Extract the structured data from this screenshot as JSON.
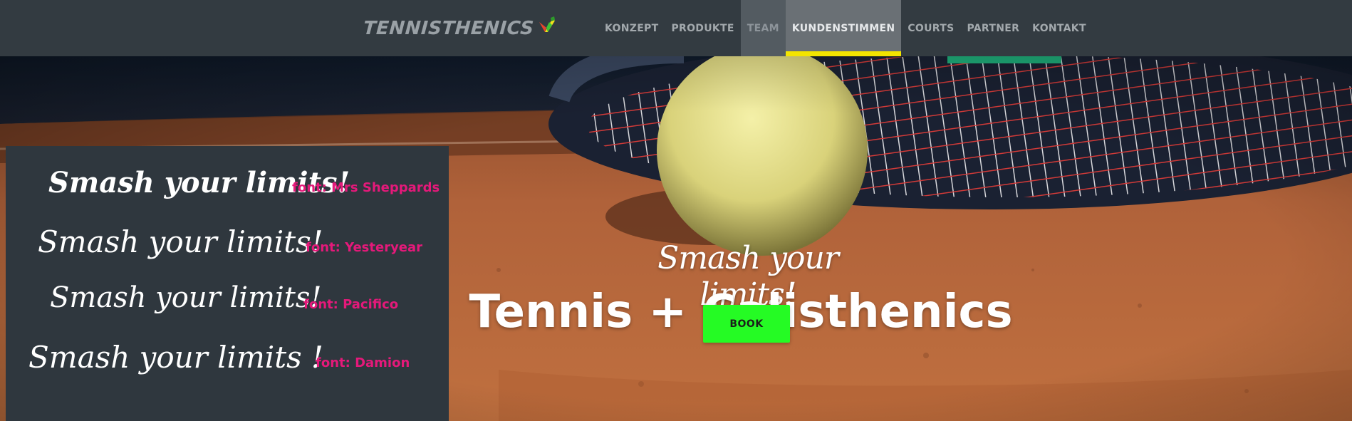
{
  "brand": {
    "name": "TENNISTHENICS",
    "logo_icon": "color-swoosh-icon"
  },
  "nav": {
    "items": [
      {
        "label": "KONZEPT"
      },
      {
        "label": "PRODUKTE"
      },
      {
        "label": "TEAM"
      },
      {
        "label": "KUNDENSTIMMEN"
      },
      {
        "label": "COURTS"
      },
      {
        "label": "PARTNER"
      },
      {
        "label": "KONTAKT"
      }
    ],
    "active_index": 3,
    "hover_index": 2
  },
  "hero": {
    "subtitle": "Smash your limits!",
    "title": "Tennis + Calisthenics",
    "cta_label": "BOOK",
    "background": "tennis-ball-and-racket-on-clay-court-photo"
  },
  "font_samples": [
    {
      "text": "Smash your limits!",
      "label": "font: Mrs Sheppards"
    },
    {
      "text": "Smash your limits!",
      "label": "font: Yesteryear"
    },
    {
      "text": "Smash your limits!",
      "label": "font: Pacifico"
    },
    {
      "text": "Smash your limits !",
      "label": "font: Damion"
    }
  ],
  "colors": {
    "header_bg": "#333b41",
    "nav_active_underline": "#f3e400",
    "cta_bg": "#25fb24",
    "label_pink": "#e5197a",
    "panel_bg": "#2f373e"
  }
}
